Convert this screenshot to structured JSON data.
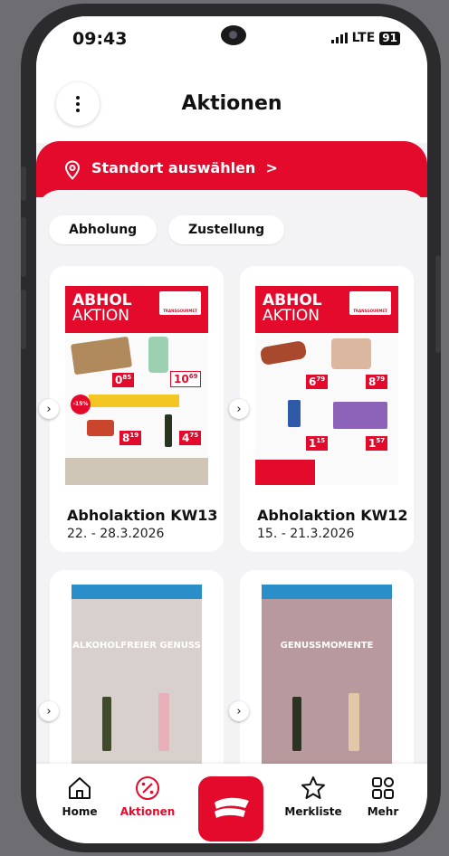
{
  "status_bar": {
    "time": "09:43",
    "network": "LTE",
    "battery": "91"
  },
  "header": {
    "title": "Aktionen"
  },
  "location": {
    "label": "Standort auswählen",
    "chevron": ">"
  },
  "filters": [
    {
      "label": "Abholung"
    },
    {
      "label": "Zustellung"
    }
  ],
  "cards": [
    {
      "title": "Abholaktion KW13",
      "date": "22. - 28.3.2026",
      "flyer_headline": "ABHOL",
      "flyer_subline": "AKTION"
    },
    {
      "title": "Abholaktion KW12",
      "date": "15. - 21.3.2026",
      "flyer_headline": "ABHOL",
      "flyer_subline": "AKTION"
    },
    {
      "flyer_caption": "ALKOHOLFREIER GENUSS"
    },
    {
      "flyer_caption": "GENUSSMOMENTE"
    }
  ],
  "nav": [
    {
      "label": "Home",
      "icon": "home-icon"
    },
    {
      "label": "Aktionen",
      "icon": "percent-icon",
      "active": true
    },
    {
      "label": "Merkliste",
      "icon": "star-icon"
    },
    {
      "label": "Mehr",
      "icon": "grid-icon"
    }
  ],
  "colors": {
    "accent": "#e30a2c",
    "background": "#f3f3f5"
  }
}
